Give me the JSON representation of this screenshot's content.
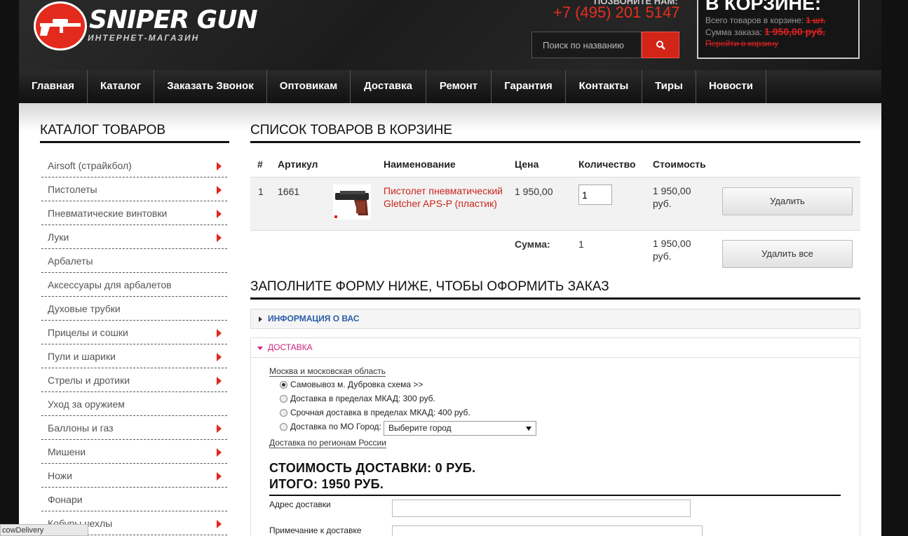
{
  "header": {
    "logo_title": "SNIPER GUN",
    "logo_subtitle": "ИНТЕРНЕТ-МАГАЗИН",
    "call_label": "ПОЗВОНИТЕ НАМ:",
    "phone": "+7 (495) 201 5147",
    "search_placeholder": "Поиск по названию"
  },
  "cart": {
    "title": "В КОРЗИНЕ:",
    "total_items_label": "Всего товаров в корзине:",
    "total_items_value": "1 шт.",
    "sum_label": "Сумма заказа:",
    "sum_value": "1 950,00 руб.",
    "link": "Перейти в корзину"
  },
  "nav": [
    {
      "label": "Главная",
      "width": 98
    },
    {
      "label": "Каталог",
      "width": 95
    },
    {
      "label": "Заказать Звонок",
      "width": 161
    },
    {
      "label": "Оптовикам",
      "width": 119
    },
    {
      "label": "Доставка",
      "width": 108
    },
    {
      "label": "Ремонт",
      "width": 93
    },
    {
      "label": "Гарантия",
      "width": 106
    },
    {
      "label": "Контакты",
      "width": 109
    },
    {
      "label": "Тиры",
      "width": 77
    },
    {
      "label": "Новости",
      "width": 100
    }
  ],
  "sidebar": {
    "title": "КАТАЛОГ ТОВАРОВ",
    "items": [
      {
        "label": "Airsoft (страйкбол)",
        "arrow": true
      },
      {
        "label": "Пистолеты",
        "arrow": true
      },
      {
        "label": "Пневматические винтовки",
        "arrow": true
      },
      {
        "label": "Луки",
        "arrow": true
      },
      {
        "label": "Арбалеты",
        "arrow": false
      },
      {
        "label": "Аксессуары для арбалетов",
        "arrow": false
      },
      {
        "label": "Духовые трубки",
        "arrow": false
      },
      {
        "label": "Прицелы и сошки",
        "arrow": true
      },
      {
        "label": "Пули и шарики",
        "arrow": true
      },
      {
        "label": "Стрелы и дротики",
        "arrow": true
      },
      {
        "label": "Уход за оружием",
        "arrow": false
      },
      {
        "label": "Баллоны и газ",
        "arrow": true
      },
      {
        "label": "Мишени",
        "arrow": true
      },
      {
        "label": "Ножи",
        "arrow": true
      },
      {
        "label": "Фонари",
        "arrow": false
      },
      {
        "label": "Кобуры чехлы",
        "arrow": true
      }
    ]
  },
  "cart_table": {
    "title": "СПИСОК ТОВАРОВ В КОРЗИНЕ",
    "headers": {
      "num": "#",
      "article": "Артикул",
      "name": "Наименование",
      "price": "Цена",
      "qty": "Количество",
      "cost": "Стоимость"
    },
    "row": {
      "num": "1",
      "article": "1661",
      "name": "Пистолет пневматический Gletcher APS-P (пластик)",
      "price": "1 950,00",
      "qty": "1",
      "cost": "1 950,00 руб.",
      "delete_label": "Удалить"
    },
    "sum": {
      "label": "Сумма:",
      "qty": "1",
      "cost": "1 950,00 руб.",
      "delete_all_label": "Удалить все"
    }
  },
  "order_form": {
    "title": "ЗАПОЛНИТЕ ФОРМУ НИЖЕ, ЧТОБЫ ОФОРМИТЬ ЗАКАЗ",
    "section_info": "ИНФОРМАЦИЯ О ВАС",
    "section_delivery": "ДОСТАВКА",
    "moscow_link": "Москва и московская область",
    "options": [
      {
        "label": "Самовывоз м. Дубровка схема >>",
        "checked": true
      },
      {
        "label": "Доставка в пределах МКАД: 300 руб.",
        "checked": false
      },
      {
        "label": "Срочная доставка в пределах МКАД: 400 руб.",
        "checked": false
      },
      {
        "label": "Доставка по МО Город:",
        "checked": false
      }
    ],
    "city_select_value": "Выберите город",
    "regions_link": "Доставка по регионам России",
    "delivery_cost": "СТОИМОСТЬ ДОСТАВКИ: 0 РУБ.",
    "total": "ИТОГО: 1950 РУБ.",
    "address_label": "Адрес доставки",
    "note_label": "Примечание к доставке"
  },
  "status_tip": "cowDelivery"
}
